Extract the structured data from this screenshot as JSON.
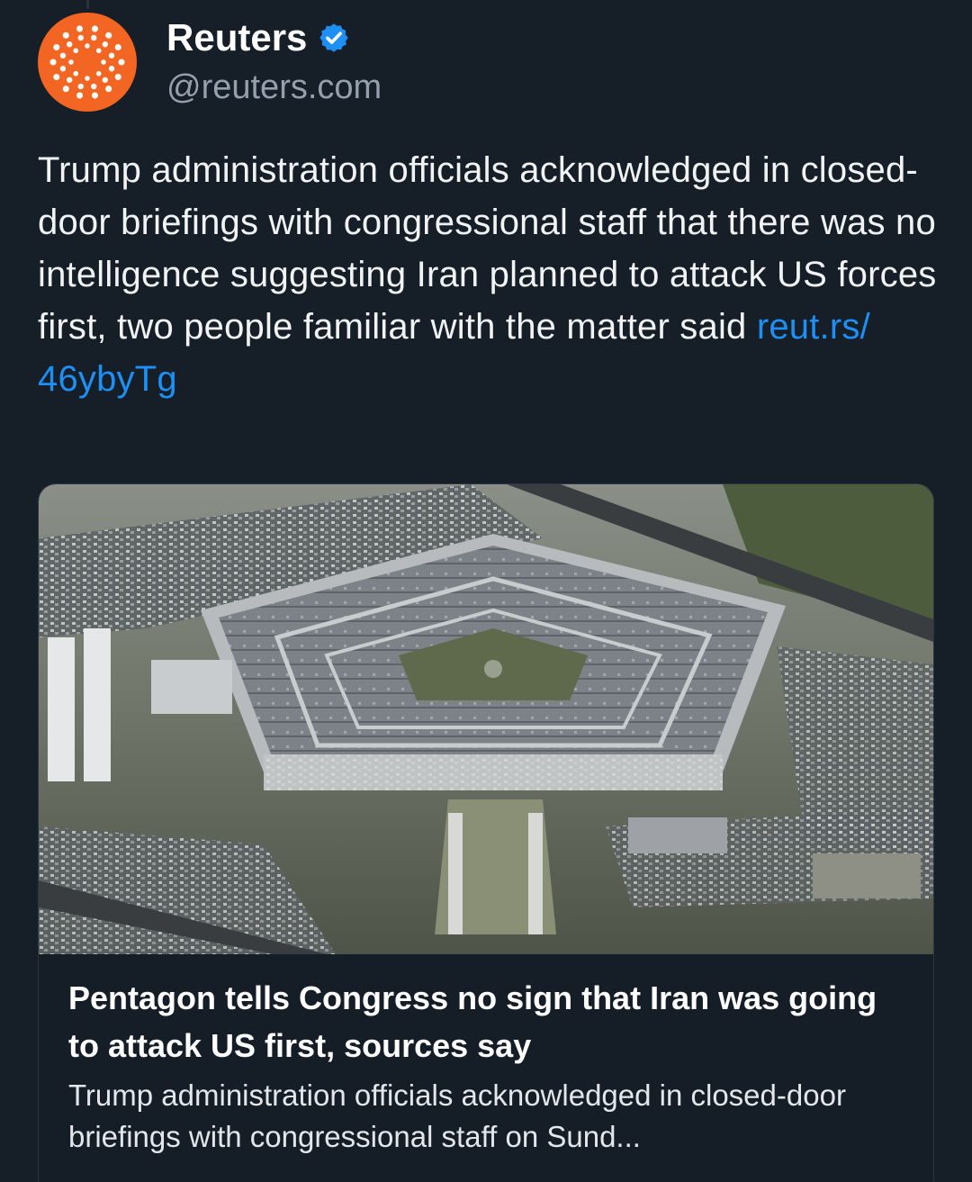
{
  "author": {
    "display_name": "Reuters",
    "handle": "@reuters.com",
    "verified": true,
    "avatar_icon": "reuters-logo",
    "avatar_color": "#f26522",
    "verified_icon": "verified-check-icon",
    "verified_color": "#1d8ff5"
  },
  "post": {
    "text": "Trump administration officials acknowledged in closed-door briefings with congressional staff that there was no intelligence suggesting Iran planned to attack US forces first, two people familiar with the matter said ",
    "link_text": "reut.rs/\n46ybyTg",
    "link_color": "#1d8ff5"
  },
  "card": {
    "image_icon": "pentagon-aerial-photo",
    "title": "Pentagon tells Congress no sign that Iran was going to attack US first, sources say",
    "description": "Trump administration officials acknowledged in closed-door briefings with congressional staff on Sund..."
  }
}
